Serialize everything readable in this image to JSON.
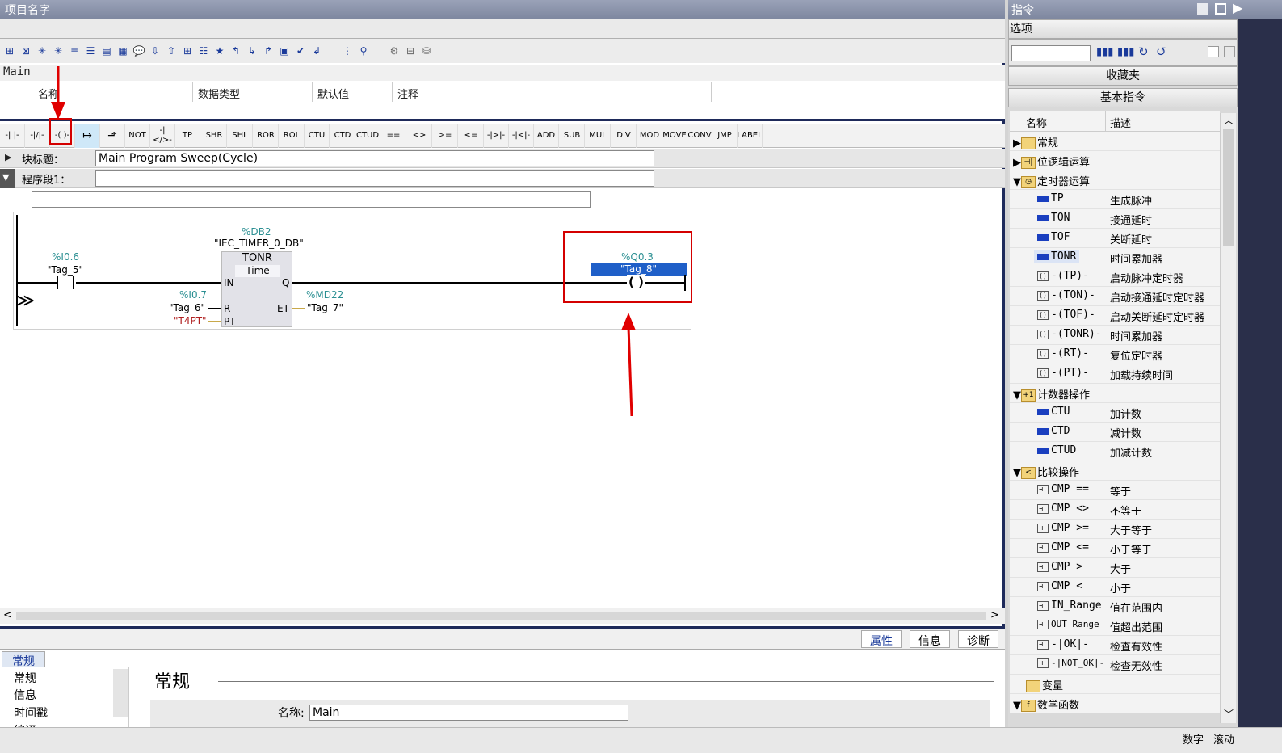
{
  "project_title": "项目名字",
  "block_name": "Main",
  "interface_headers": [
    "名称",
    "数据类型",
    "默认值",
    "注释"
  ],
  "ladder_toolbar": [
    "-| |-",
    "-|/|-",
    "-( )-",
    "↦",
    "⬏",
    "NOT",
    "-|</>-",
    "TP",
    "SHR",
    "SHL",
    "ROR",
    "ROL",
    "CTU",
    "CTD",
    "CTUD",
    "==",
    "<>",
    ">=",
    "<=",
    "-|>|-",
    "-|<|-",
    "ADD",
    "SUB",
    "MUL",
    "DIV",
    "MOD",
    "MOVE",
    "CONV",
    "JMP",
    "LABEL"
  ],
  "block_title_label": "块标题：",
  "block_title_value": "Main Program Sweep(Cycle)",
  "network_label": "程序段1：",
  "network": {
    "contact1_addr": "%I0.6",
    "contact1_tag": "\"Tag_5\"",
    "db_addr": "%DB2",
    "db_name": "\"IEC_TIMER_0_DB\"",
    "fb_type": "TONR",
    "fb_subtype": "Time",
    "pin_in": "IN",
    "pin_q": "Q",
    "pin_r": "R",
    "pin_et": "ET",
    "pin_pt": "PT",
    "r_addr": "%I0.7",
    "r_tag": "\"Tag_6\"",
    "pt_value": "\"T4PT\"",
    "et_addr": "%MD22",
    "et_tag": "\"Tag_7\"",
    "coil_addr": "%Q0.3",
    "coil_tag": "\"Tag_8\"",
    "coil_symbol": "( )"
  },
  "bottom": {
    "tabs": [
      "属性",
      "信息",
      "诊断"
    ],
    "left_tab": "常规",
    "nav_items": [
      "常规",
      "信息",
      "时间戳",
      "编译"
    ],
    "section_title": "常规",
    "name_label": "名称:",
    "name_value": "Main"
  },
  "status": {
    "num": "数字",
    "scroll": "滚动"
  },
  "right": {
    "title": "指令",
    "options": "选项",
    "favorites": "收藏夹",
    "basic": "基本指令",
    "col_name": "名称",
    "col_desc": "描述",
    "tree": [
      {
        "name": "常规",
        "desc": "",
        "kind": "folder",
        "level": 0,
        "open": false
      },
      {
        "name": "位逻辑运算",
        "desc": "",
        "kind": "folder",
        "level": 0,
        "open": false
      },
      {
        "name": "定时器运算",
        "desc": "",
        "kind": "folder",
        "level": 0,
        "open": true
      },
      {
        "name": "TP",
        "desc": "生成脉冲",
        "kind": "block",
        "level": 1
      },
      {
        "name": "TON",
        "desc": "接通延时",
        "kind": "block",
        "level": 1
      },
      {
        "name": "TOF",
        "desc": "关断延时",
        "kind": "block",
        "level": 1
      },
      {
        "name": "TONR",
        "desc": "时间累加器",
        "kind": "block",
        "level": 1,
        "selected": true
      },
      {
        "name": "-(TP)-",
        "desc": "启动脉冲定时器",
        "kind": "coil",
        "level": 1
      },
      {
        "name": "-(TON)-",
        "desc": "启动接通延时定时器",
        "kind": "coil",
        "level": 1
      },
      {
        "name": "-(TOF)-",
        "desc": "启动关断延时定时器",
        "kind": "coil",
        "level": 1
      },
      {
        "name": "-(TONR)-",
        "desc": "时间累加器",
        "kind": "coil",
        "level": 1
      },
      {
        "name": "-(RT)-",
        "desc": "复位定时器",
        "kind": "coil",
        "level": 1
      },
      {
        "name": "-(PT)-",
        "desc": "加载持续时间",
        "kind": "coil",
        "level": 1
      },
      {
        "name": "计数器操作",
        "desc": "",
        "kind": "folder",
        "level": 0,
        "open": true
      },
      {
        "name": "CTU",
        "desc": "加计数",
        "kind": "block",
        "level": 1
      },
      {
        "name": "CTD",
        "desc": "减计数",
        "kind": "block",
        "level": 1
      },
      {
        "name": "CTUD",
        "desc": "加减计数",
        "kind": "block",
        "level": 1
      },
      {
        "name": "比较操作",
        "desc": "",
        "kind": "folder",
        "level": 0,
        "open": true
      },
      {
        "name": "CMP ==",
        "desc": "等于",
        "kind": "cmp",
        "level": 1
      },
      {
        "name": "CMP <>",
        "desc": "不等于",
        "kind": "cmp",
        "level": 1
      },
      {
        "name": "CMP >=",
        "desc": "大于等于",
        "kind": "cmp",
        "level": 1
      },
      {
        "name": "CMP <=",
        "desc": "小于等于",
        "kind": "cmp",
        "level": 1
      },
      {
        "name": "CMP >",
        "desc": "大于",
        "kind": "cmp",
        "level": 1
      },
      {
        "name": "CMP <",
        "desc": "小于",
        "kind": "cmp",
        "level": 1
      },
      {
        "name": "IN_Range",
        "desc": "值在范围内",
        "kind": "cmp",
        "level": 1
      },
      {
        "name": "OUT_Range",
        "desc": "值超出范围",
        "kind": "cmp",
        "level": 1
      },
      {
        "name": "-|OK|-",
        "desc": "检查有效性",
        "kind": "cmp",
        "level": 1
      },
      {
        "name": "-|NOT_OK|-",
        "desc": "检查无效性",
        "kind": "cmp",
        "level": 1
      },
      {
        "name": "变量",
        "desc": "",
        "kind": "folder",
        "level": 0,
        "open": false
      },
      {
        "name": "数学函数",
        "desc": "",
        "kind": "folder",
        "level": 0,
        "open": true
      }
    ]
  }
}
